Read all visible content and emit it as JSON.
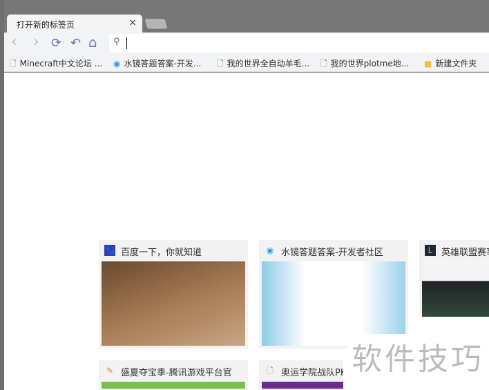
{
  "tab": {
    "title": "打开新的标签页",
    "close": "×"
  },
  "toolbar": {
    "back": "‹",
    "forward": "›",
    "reload": "⟳",
    "undo": "↶",
    "home": "⌂",
    "search_icon": "🔍",
    "address_value": ""
  },
  "bookmarks": [
    {
      "label": "Minecraft中文论坛 ...",
      "icon": "page-icon"
    },
    {
      "label": "水镜答题答案-开发...",
      "icon": "site-icon"
    },
    {
      "label": "我的世界全自动羊毛...",
      "icon": "page-icon"
    },
    {
      "label": "我的世界plotme地...",
      "icon": "page-icon"
    },
    {
      "label": "新建文件夹",
      "icon": "folder-icon"
    }
  ],
  "tiles": [
    {
      "title": "百度一下，你就知道"
    },
    {
      "title": "水镜答题答案-开发者社区"
    },
    {
      "title": "英雄联盟赛事"
    },
    {
      "title": "盛夏夺宝季-腾讯游戏平台官"
    },
    {
      "title": "奥运学院战队PK"
    }
  ],
  "watermark": "软件技巧"
}
